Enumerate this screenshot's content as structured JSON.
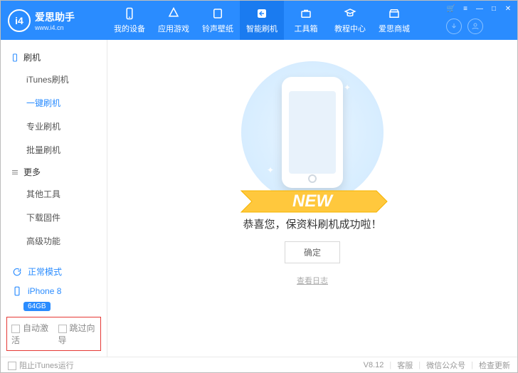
{
  "app": {
    "name": "爱思助手",
    "domain": "www.i4.cn",
    "logo_text": "i4"
  },
  "nav": [
    {
      "id": "device",
      "label": "我的设备"
    },
    {
      "id": "apps",
      "label": "应用游戏"
    },
    {
      "id": "ring",
      "label": "铃声壁纸"
    },
    {
      "id": "flash",
      "label": "智能刷机",
      "active": true
    },
    {
      "id": "tools",
      "label": "工具箱"
    },
    {
      "id": "tutorial",
      "label": "教程中心"
    },
    {
      "id": "mall",
      "label": "爱思商城"
    }
  ],
  "sidebar": {
    "group1_title": "刷机",
    "group1": [
      {
        "id": "itunes-flash",
        "label": "iTunes刷机"
      },
      {
        "id": "oneclick-flash",
        "label": "一键刷机",
        "active": true
      },
      {
        "id": "pro-flash",
        "label": "专业刷机"
      },
      {
        "id": "batch-flash",
        "label": "批量刷机"
      }
    ],
    "group2_title": "更多",
    "group2": [
      {
        "id": "other-tools",
        "label": "其他工具"
      },
      {
        "id": "download-firmware",
        "label": "下载固件"
      },
      {
        "id": "advanced",
        "label": "高级功能"
      }
    ],
    "mode": "正常模式",
    "device": "iPhone 8",
    "device_storage": "64GB",
    "opt_auto_activate": "自动激活",
    "opt_skip_wizard": "跳过向导"
  },
  "content": {
    "ribbon_text": "NEW",
    "success_msg": "恭喜您，保资料刷机成功啦！",
    "ok_btn": "确定",
    "view_log": "查看日志"
  },
  "footer": {
    "block_itunes": "阻止iTunes运行",
    "version": "V8.12",
    "support": "客服",
    "wechat": "微信公众号",
    "check_update": "检查更新"
  }
}
